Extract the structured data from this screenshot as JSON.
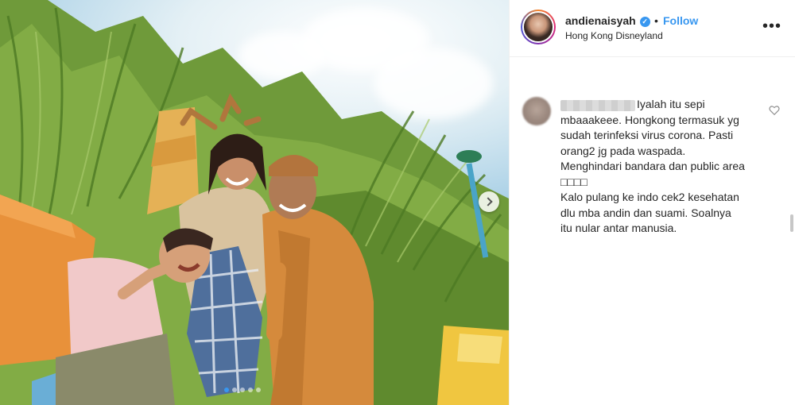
{
  "post": {
    "username": "andienaisyah",
    "separator": "•",
    "follow_label": "Follow",
    "location": "Hong Kong Disneyland",
    "more_label": "•••",
    "verified_glyph": "✓"
  },
  "carousel": {
    "slide_count": 5,
    "active_slide": 1
  },
  "comment": {
    "text": "Iyalah itu sepi mbaaakeee. Hongkong termasuk yg sudah terinfeksi virus corona. Pasti orang2 jg pada waspada. Menghindari bandara dan public area □□□□\nKalo pulang ke indo cek2 kesehatan dlu mba andin dan suami. Soalnya itu nular antar manusia."
  },
  "icons": {
    "verified": "verified-badge-icon",
    "more": "more-options-icon",
    "like": "heart-icon",
    "next": "chevron-right-icon"
  },
  "colors": {
    "link_blue": "#3897f0",
    "text": "#262626",
    "border": "#efefef"
  }
}
